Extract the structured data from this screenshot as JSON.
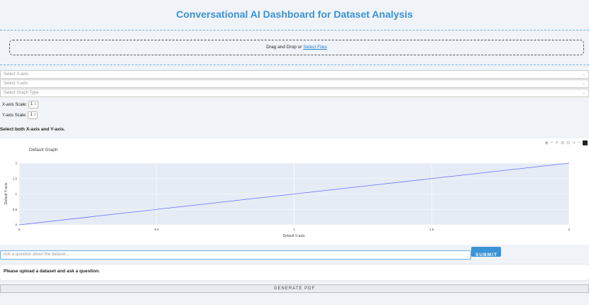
{
  "header": {
    "title": "Conversational AI Dashboard for Dataset Analysis"
  },
  "upload": {
    "prefix": "Drag and Drop or ",
    "link": "Select Files"
  },
  "controls": {
    "x_axis_placeholder": "Select X-axis",
    "y_axis_placeholder": "Select Y-axis",
    "graph_type_placeholder": "Select Graph Type",
    "x_scale_label": "X-axis Scale:",
    "x_scale_value": "1",
    "y_scale_label": "Y-axis Scale:",
    "y_scale_value": "1",
    "chevron": "⌄"
  },
  "status_message": "Select both X-axis and Y-axis.",
  "modebar": {
    "icons": [
      "camera-icon",
      "zoom-icon",
      "pan-icon",
      "zoom-in-icon",
      "zoom-out-icon",
      "autoscale-icon",
      "reset-axes-icon",
      "plotly-logo-icon"
    ]
  },
  "chart_data": {
    "type": "line",
    "title": "Default Graph",
    "xlabel": "Default X-axis",
    "ylabel": "Default Y-axis",
    "x": [
      0,
      2
    ],
    "y": [
      0,
      2
    ],
    "xlim": [
      0,
      2
    ],
    "ylim": [
      0,
      2
    ],
    "x_ticks": [
      "0",
      "0.5",
      "1",
      "1.5",
      "2"
    ],
    "y_ticks": [
      "0",
      "0.5",
      "1",
      "1.5",
      "2"
    ],
    "grid": true,
    "line_color": "#636efa",
    "plot_bg": "#e5ecf6"
  },
  "qa": {
    "placeholder": "Ask a question about the dataset...",
    "submit_label": "SUBMIT",
    "answer": "Please upload a dataset and ask a question."
  },
  "generate_pdf_label": "GENERATE PDF"
}
